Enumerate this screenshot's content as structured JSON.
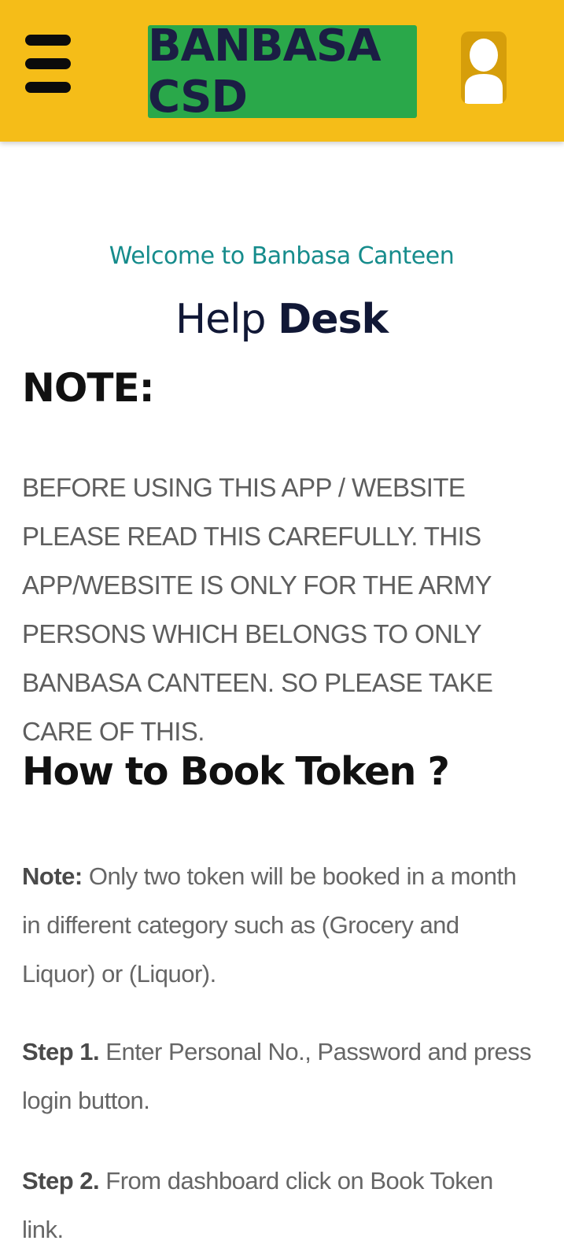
{
  "header": {
    "brand_label": "BANBASA CSD",
    "menu_icon": "hamburger-menu-icon",
    "user_icon": "user-profile-icon",
    "colors": {
      "header_bg": "#f5bd18",
      "brand_bg": "#2aa84a",
      "brand_text": "#1b1e44",
      "user_icon_bg": "#d69e0a"
    }
  },
  "main": {
    "welcome": "Welcome to Banbasa Canteen",
    "helpdesk_light": "Help",
    "helpdesk_bold": "Desk",
    "note_title": "NOTE:",
    "note_text": "BEFORE USING THIS APP / WEBSITE PLEASE READ THIS CAREFULLY. THIS APP/WEBSITE IS ONLY FOR THE ARMY PERSONS WHICH BELONGS TO ONLY BANBASA CANTEEN. SO PLEASE TAKE CARE OF THIS.",
    "howto_title": "How to Book Token ?",
    "steps": [
      {
        "label": "Note:",
        "text": "Only two token will be booked in a month in different category such as (Grocery and Liquor) or (Liquor)."
      },
      {
        "label": "Step 1.",
        "text": "Enter Personal No., Password and press login button."
      },
      {
        "label": "Step 2.",
        "text": "From dashboard click on Book Token link."
      }
    ],
    "colors": {
      "welcome": "#168c8c",
      "heading": "#111111",
      "body_text": "#5e5e5e"
    }
  }
}
